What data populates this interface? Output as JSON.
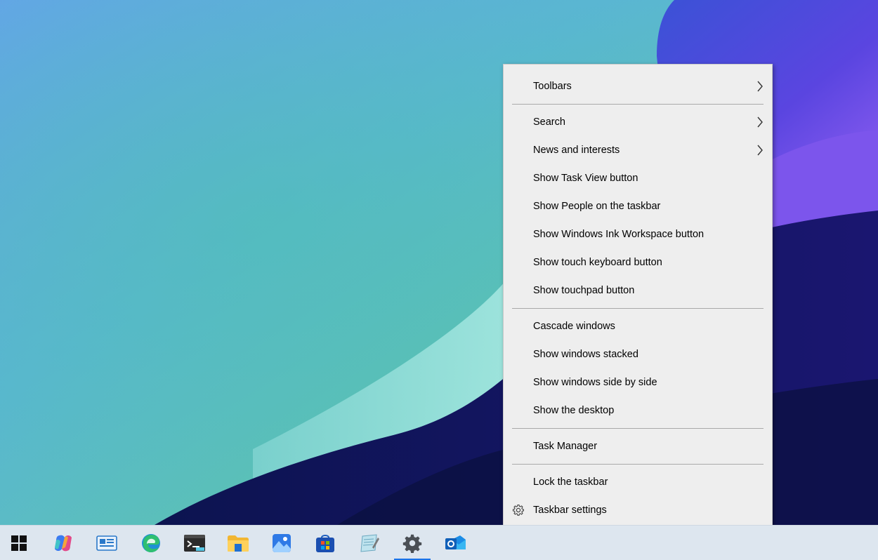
{
  "context_menu": {
    "items": [
      {
        "label": "Toolbars",
        "submenu": true
      },
      {
        "label": "Search",
        "submenu": true
      },
      {
        "label": "News and interests",
        "submenu": true
      },
      {
        "label": "Show Task View button",
        "submenu": false
      },
      {
        "label": "Show People on the taskbar",
        "submenu": false
      },
      {
        "label": "Show Windows Ink Workspace button",
        "submenu": false
      },
      {
        "label": "Show touch keyboard button",
        "submenu": false
      },
      {
        "label": "Show touchpad button",
        "submenu": false
      },
      {
        "label": "Cascade windows",
        "submenu": false
      },
      {
        "label": "Show windows stacked",
        "submenu": false
      },
      {
        "label": "Show windows side by side",
        "submenu": false
      },
      {
        "label": "Show the desktop",
        "submenu": false
      },
      {
        "label": "Task Manager",
        "submenu": false
      },
      {
        "label": "Lock the taskbar",
        "submenu": false
      },
      {
        "label": "Taskbar settings",
        "submenu": false,
        "icon": "gear-icon"
      }
    ]
  },
  "taskbar": {
    "apps": [
      {
        "name": "start-button",
        "icon": "windows-logo-icon"
      },
      {
        "name": "copilot",
        "icon": "copilot-icon"
      },
      {
        "name": "widgets",
        "icon": "widgets-icon"
      },
      {
        "name": "edge",
        "icon": "edge-icon"
      },
      {
        "name": "terminal",
        "icon": "terminal-icon"
      },
      {
        "name": "file-explorer",
        "icon": "folder-icon"
      },
      {
        "name": "photos",
        "icon": "photos-icon"
      },
      {
        "name": "store",
        "icon": "store-icon"
      },
      {
        "name": "notepad",
        "icon": "notepad-icon"
      },
      {
        "name": "settings",
        "icon": "gear-icon",
        "active": true
      },
      {
        "name": "outlook",
        "icon": "outlook-icon"
      }
    ]
  },
  "colors": {
    "menu_background": "#eeeeee",
    "separator": "#a9a9a9",
    "taskbar_background": "#dde6ef",
    "active_indicator": "#1a73e8"
  }
}
